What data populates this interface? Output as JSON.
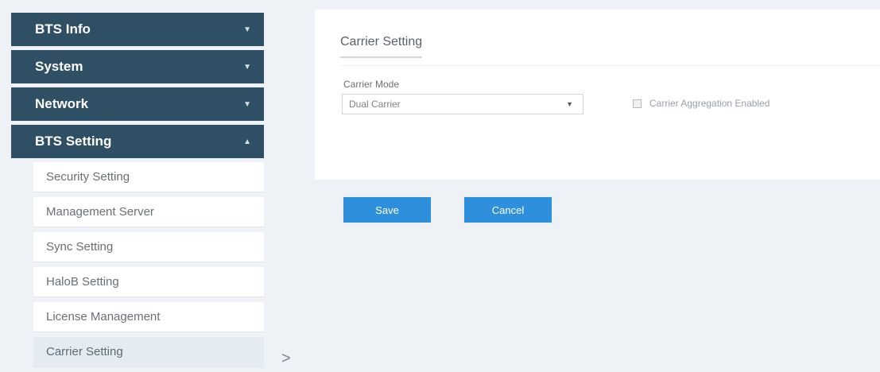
{
  "sidebar": {
    "groups": [
      {
        "label": "BTS Info",
        "expanded": false
      },
      {
        "label": "System",
        "expanded": false
      },
      {
        "label": "Network",
        "expanded": false
      },
      {
        "label": "BTS Setting",
        "expanded": true
      }
    ],
    "sub_items": [
      {
        "label": "Security Setting"
      },
      {
        "label": "Management Server"
      },
      {
        "label": "Sync Setting"
      },
      {
        "label": "HaloB Setting"
      },
      {
        "label": "License Management"
      },
      {
        "label": "Carrier Setting",
        "active": true
      }
    ],
    "collapse_glyph": ">"
  },
  "panel": {
    "title": "Carrier Setting",
    "carrier_mode": {
      "label": "Carrier Mode",
      "value": "Dual Carrier"
    },
    "aggregation": {
      "label": "Carrier Aggregation Enabled",
      "checked": false,
      "disabled": true
    }
  },
  "buttons": {
    "save": "Save",
    "cancel": "Cancel"
  },
  "colors": {
    "nav_header": "#2f4f65",
    "button": "#2e8fdd",
    "background": "#eef1f5"
  }
}
